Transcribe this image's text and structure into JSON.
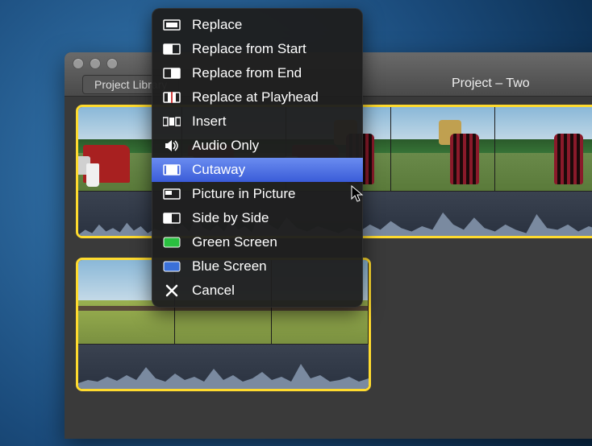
{
  "titlebar": {
    "breadcrumb": "Project Library",
    "project_title": "Project – Two"
  },
  "menu": {
    "items": [
      {
        "id": "replace",
        "label": "Replace",
        "icon": "replace-icon"
      },
      {
        "id": "replace-from-start",
        "label": "Replace from Start",
        "icon": "replace-start-icon"
      },
      {
        "id": "replace-from-end",
        "label": "Replace from End",
        "icon": "replace-end-icon"
      },
      {
        "id": "replace-at-playhead",
        "label": "Replace at Playhead",
        "icon": "replace-playhead-icon"
      },
      {
        "id": "insert",
        "label": "Insert",
        "icon": "insert-icon"
      },
      {
        "id": "audio-only",
        "label": "Audio Only",
        "icon": "audio-icon"
      },
      {
        "id": "cutaway",
        "label": "Cutaway",
        "icon": "cutaway-icon",
        "selected": true
      },
      {
        "id": "picture-in-picture",
        "label": "Picture in Picture",
        "icon": "pip-icon"
      },
      {
        "id": "side-by-side",
        "label": "Side by Side",
        "icon": "side-by-side-icon"
      },
      {
        "id": "green-screen",
        "label": "Green Screen",
        "icon": "green-screen-icon"
      },
      {
        "id": "blue-screen",
        "label": "Blue Screen",
        "icon": "blue-screen-icon"
      },
      {
        "id": "cancel",
        "label": "Cancel",
        "icon": "cancel-icon"
      }
    ]
  }
}
